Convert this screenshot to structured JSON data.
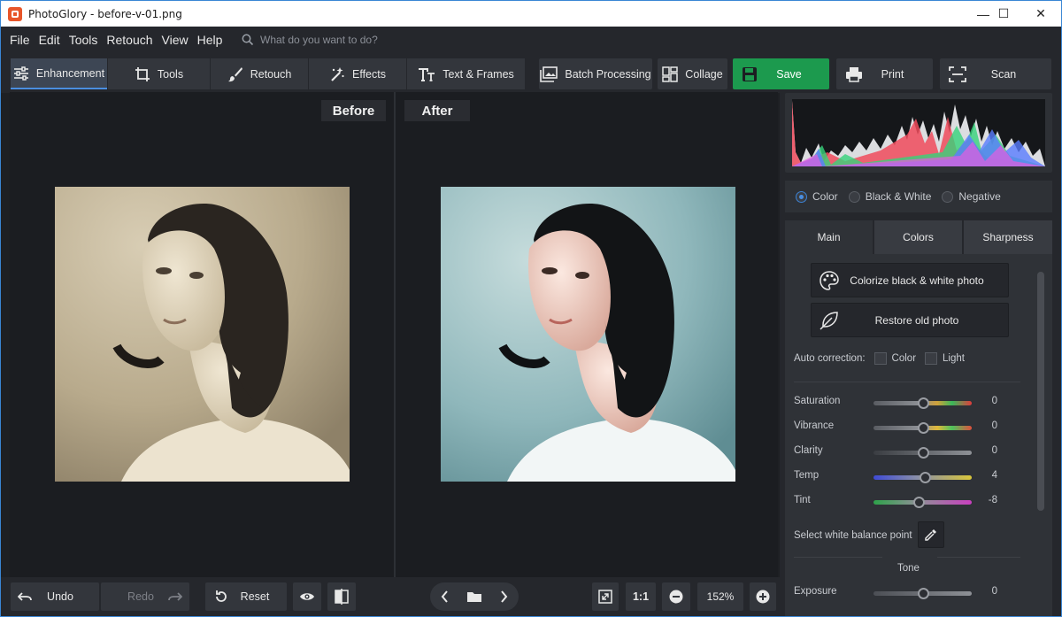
{
  "window": {
    "title": "PhotoGlory - before-v-01.png",
    "minimize": "—",
    "maximize": "☐",
    "close": "✕"
  },
  "menu": {
    "items": [
      "File",
      "Edit",
      "Tools",
      "Retouch",
      "View",
      "Help"
    ],
    "search_placeholder": "What do you want to do?"
  },
  "toolbar": {
    "tabs": [
      "Enhancement",
      "Tools",
      "Retouch",
      "Effects",
      "Text & Frames"
    ],
    "batch": "Batch Processing",
    "collage": "Collage",
    "save": "Save",
    "print": "Print",
    "scan": "Scan"
  },
  "canvas": {
    "before_label": "Before",
    "after_label": "After"
  },
  "bottom": {
    "undo": "Undo",
    "redo": "Redo",
    "reset": "Reset",
    "one_to_one": "1:1",
    "zoom": "152%"
  },
  "modes": {
    "options": [
      "Color",
      "Black & White",
      "Negative"
    ],
    "selected": "Color"
  },
  "panel_tabs": [
    "Main",
    "Colors",
    "Sharpness"
  ],
  "main": {
    "colorize": "Colorize black & white photo",
    "restore": "Restore old photo",
    "auto_correction": "Auto correction:",
    "auto_color": "Color",
    "auto_light": "Light",
    "sliders": [
      {
        "label": "Saturation",
        "value": "0",
        "level": 0.5
      },
      {
        "label": "Vibrance",
        "value": "0",
        "level": 0.5
      },
      {
        "label": "Clarity",
        "value": "0",
        "level": 0.5
      },
      {
        "label": "Temp",
        "value": "4",
        "level": 0.52
      },
      {
        "label": "Tint",
        "value": "-8",
        "level": 0.46
      }
    ],
    "white_balance": "Select white balance point",
    "tone": "Tone",
    "exposure": {
      "label": "Exposure",
      "value": "0",
      "level": 0.5
    }
  },
  "colors": {
    "accent": "#4a8ee0",
    "save_green": "#1c9a4e",
    "app_icon": "#e8562a"
  }
}
